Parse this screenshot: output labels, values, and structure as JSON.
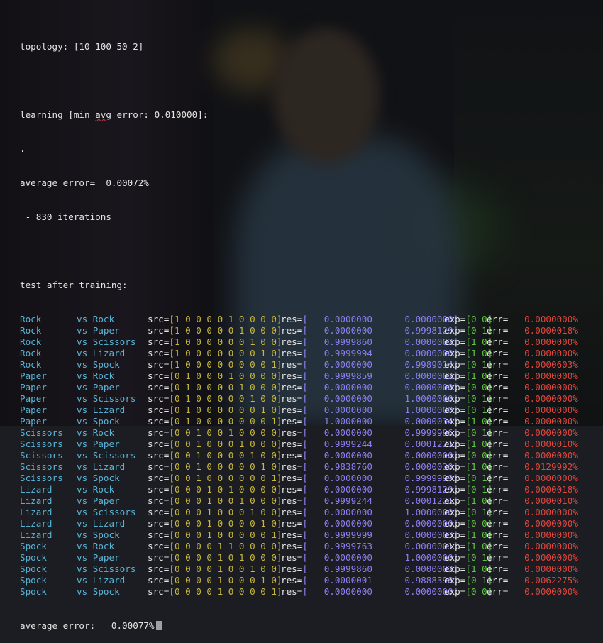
{
  "header": {
    "topology": "topology: [10 100 50 2]",
    "learning": "learning [min avg error: 0.010000]:",
    "progress_dot": ".",
    "average_error": "average error=  0.00072%",
    "iterations": " - 830 iterations",
    "test_heading": "test after training:"
  },
  "labels": {
    "vs": "vs",
    "src": "src=",
    "res": "res=",
    "exp": "exp=",
    "err": "err="
  },
  "rows": [
    {
      "a": "Rock",
      "b": "Rock",
      "src": "1 0 0 0 0 1 0 0 0 0",
      "r1": "0.0000000",
      "r2": "0.0000000",
      "exp": "0 0",
      "err": "0.0000000%"
    },
    {
      "a": "Rock",
      "b": "Paper",
      "src": "1 0 0 0 0 0 1 0 0 0",
      "r1": "0.0000000",
      "r2": "0.9998129",
      "exp": "0 1",
      "err": "0.0000018%"
    },
    {
      "a": "Rock",
      "b": "Scissors",
      "src": "1 0 0 0 0 0 0 1 0 0",
      "r1": "0.9999860",
      "r2": "0.0000002",
      "exp": "1 0",
      "err": "0.0000000%"
    },
    {
      "a": "Rock",
      "b": "Lizard",
      "src": "1 0 0 0 0 0 0 0 1 0",
      "r1": "0.9999994",
      "r2": "0.0000000",
      "exp": "1 0",
      "err": "0.0000000%"
    },
    {
      "a": "Rock",
      "b": "Spock",
      "src": "1 0 0 0 0 0 0 0 0 1",
      "r1": "0.0000000",
      "r2": "0.9989014",
      "exp": "0 1",
      "err": "0.0000603%"
    },
    {
      "a": "Paper",
      "b": "Rock",
      "src": "0 1 0 0 0 1 0 0 0 0",
      "r1": "0.9999859",
      "r2": "0.0000002",
      "exp": "1 0",
      "err": "0.0000000%"
    },
    {
      "a": "Paper",
      "b": "Paper",
      "src": "0 1 0 0 0 0 1 0 0 0",
      "r1": "0.0000000",
      "r2": "0.0000000",
      "exp": "0 0",
      "err": "0.0000000%"
    },
    {
      "a": "Paper",
      "b": "Scissors",
      "src": "0 1 0 0 0 0 0 1 0 0",
      "r1": "0.0000000",
      "r2": "1.0000000",
      "exp": "0 1",
      "err": "0.0000000%"
    },
    {
      "a": "Paper",
      "b": "Lizard",
      "src": "0 1 0 0 0 0 0 0 1 0",
      "r1": "0.0000000",
      "r2": "1.0000000",
      "exp": "0 1",
      "err": "0.0000000%"
    },
    {
      "a": "Paper",
      "b": "Spock",
      "src": "0 1 0 0 0 0 0 0 0 1",
      "r1": "1.0000000",
      "r2": "0.0000034",
      "exp": "1 0",
      "err": "0.0000000%"
    },
    {
      "a": "Scissors",
      "b": "Rock",
      "src": "0 0 1 0 0 1 0 0 0 0",
      "r1": "0.0000000",
      "r2": "0.9999996",
      "exp": "0 1",
      "err": "0.0000000%"
    },
    {
      "a": "Scissors",
      "b": "Paper",
      "src": "0 0 1 0 0 0 1 0 0 0",
      "r1": "0.9999244",
      "r2": "0.0001221",
      "exp": "1 0",
      "err": "0.0000010%"
    },
    {
      "a": "Scissors",
      "b": "Scissors",
      "src": "0 0 1 0 0 0 0 1 0 0",
      "r1": "0.0000000",
      "r2": "0.0000000",
      "exp": "0 0",
      "err": "0.0000000%"
    },
    {
      "a": "Scissors",
      "b": "Lizard",
      "src": "0 0 1 0 0 0 0 0 1 0",
      "r1": "0.9838760",
      "r2": "0.0000030",
      "exp": "1 0",
      "err": "0.0129992%"
    },
    {
      "a": "Scissors",
      "b": "Spock",
      "src": "0 0 1 0 0 0 0 0 0 1",
      "r1": "0.0000000",
      "r2": "0.9999999",
      "exp": "0 1",
      "err": "0.0000000%"
    },
    {
      "a": "Lizard",
      "b": "Rock",
      "src": "0 0 0 1 0 1 0 0 0 0",
      "r1": "0.0000000",
      "r2": "0.9998129",
      "exp": "0 1",
      "err": "0.0000018%"
    },
    {
      "a": "Lizard",
      "b": "Paper",
      "src": "0 0 0 1 0 0 1 0 0 0",
      "r1": "0.9999244",
      "r2": "0.0001221",
      "exp": "1 0",
      "err": "0.0000010%"
    },
    {
      "a": "Lizard",
      "b": "Scissors",
      "src": "0 0 0 1 0 0 0 1 0 0",
      "r1": "0.0000000",
      "r2": "1.0000000",
      "exp": "0 1",
      "err": "0.0000000%"
    },
    {
      "a": "Lizard",
      "b": "Lizard",
      "src": "0 0 0 1 0 0 0 0 1 0",
      "r1": "0.0000000",
      "r2": "0.0000000",
      "exp": "0 0",
      "err": "0.0000000%"
    },
    {
      "a": "Lizard",
      "b": "Spock",
      "src": "0 0 0 1 0 0 0 0 0 1",
      "r1": "0.9999999",
      "r2": "0.0000003",
      "exp": "1 0",
      "err": "0.0000000%"
    },
    {
      "a": "Spock",
      "b": "Rock",
      "src": "0 0 0 0 1 1 0 0 0 0",
      "r1": "0.9999763",
      "r2": "0.0000001",
      "exp": "1 0",
      "err": "0.0000000%"
    },
    {
      "a": "Spock",
      "b": "Paper",
      "src": "0 0 0 0 1 0 1 0 0 0",
      "r1": "0.0000000",
      "r2": "1.0000000",
      "exp": "0 1",
      "err": "0.0000000%"
    },
    {
      "a": "Spock",
      "b": "Scissors",
      "src": "0 0 0 0 1 0 0 1 0 0",
      "r1": "0.9999860",
      "r2": "0.0000002",
      "exp": "1 0",
      "err": "0.0000000%"
    },
    {
      "a": "Spock",
      "b": "Lizard",
      "src": "0 0 0 0 1 0 0 0 1 0",
      "r1": "0.0000001",
      "r2": "0.9888398",
      "exp": "0 1",
      "err": "0.0062275%"
    },
    {
      "a": "Spock",
      "b": "Spock",
      "src": "0 0 0 0 1 0 0 0 0 1",
      "r1": "0.0000000",
      "r2": "0.0000000",
      "exp": "0 0",
      "err": "0.0000000%"
    }
  ],
  "footer": {
    "average_error": "average error:   0.00077%"
  },
  "colors": {
    "label": "#59b3d6",
    "src_bits": "#c9b83c",
    "res_vals": "#8b7ff0",
    "exp_bits": "#5cc63d",
    "err_vals": "#e0453c",
    "text": "#e4e4e4"
  }
}
